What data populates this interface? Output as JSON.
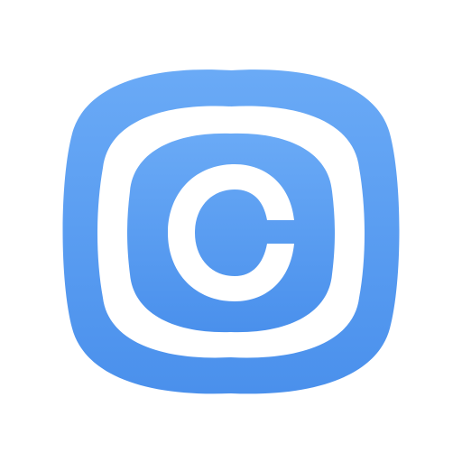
{
  "icon": {
    "name": "copyright-icon",
    "glyph": "C",
    "colors": {
      "background": "#ffffff",
      "gradient_top": "#6aaaf6",
      "gradient_bottom": "#4a90ec",
      "inner_fill": "#ffffff"
    }
  }
}
